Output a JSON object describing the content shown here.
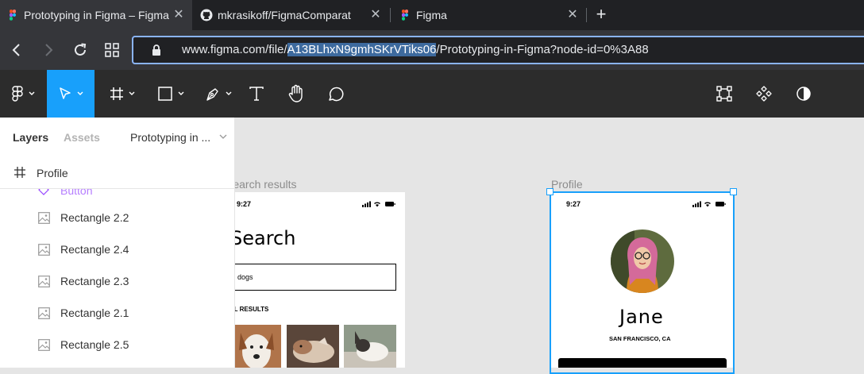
{
  "browser": {
    "tabs": [
      {
        "title": "Prototyping in Figma – Figma",
        "icon": "figma-icon",
        "active": true
      },
      {
        "title": "mkrasikoff/FigmaComparat",
        "icon": "github-icon",
        "active": false
      },
      {
        "title": "Figma",
        "icon": "figma-icon",
        "active": false
      }
    ],
    "new_tab_label": "+",
    "close_glyph": "✕",
    "url_prefix": "www.figma.com/file/",
    "url_selected": "A13BLhxN9gmhSKrVTiks06",
    "url_suffix": "/Prototyping-in-Figma?node-id=0%3A88"
  },
  "toolbar": {
    "tools": [
      "main-menu",
      "move",
      "frame",
      "shape",
      "pen",
      "text",
      "hand",
      "comment"
    ],
    "active_tool": "move",
    "right_tools": [
      "edit-object",
      "components",
      "contrast"
    ]
  },
  "left_panel": {
    "tabs": {
      "layers": "Layers",
      "assets": "Assets"
    },
    "page": "Prototyping in ...",
    "frame": "Profile",
    "partial_layer": "Button",
    "layers": [
      {
        "label": "Rectangle 2.2"
      },
      {
        "label": "Rectangle 2.4"
      },
      {
        "label": "Rectangle 2.3"
      },
      {
        "label": "Rectangle 2.1"
      },
      {
        "label": "Rectangle 2.5"
      }
    ]
  },
  "canvas": {
    "search_frame": {
      "label": "Search results",
      "time": "9:27",
      "title": "Search",
      "query": "dogs",
      "results_label": "ALL RESULTS"
    },
    "profile_frame": {
      "label": "Profile",
      "time": "9:27",
      "name": "Jane",
      "location": "SAN FRANCISCO, CA"
    }
  },
  "colors": {
    "accent": "#18a0fb",
    "toolbar": "#2c2c2c",
    "canvas": "#e5e5e5"
  }
}
